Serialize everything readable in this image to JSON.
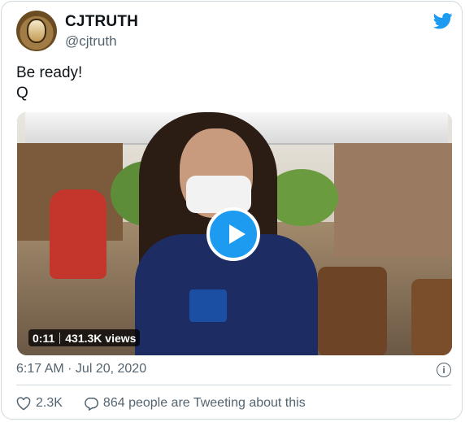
{
  "tweet": {
    "display_name": "CJTRUTH",
    "handle": "@cjtruth",
    "text_line1": "Be ready!",
    "text_line2": "Q",
    "timestamp": "6:17 AM · Jul 20, 2020"
  },
  "video": {
    "duration": "0:11",
    "views": "431.3K views"
  },
  "actions": {
    "likes": "2.3K",
    "tweeting": "864 people are Tweeting about this"
  },
  "icons": {
    "brand": "twitter-bird-icon",
    "play": "play-icon",
    "info": "info-icon",
    "like": "heart-icon",
    "reply": "speech-bubble-icon"
  },
  "colors": {
    "accent": "#1d9bf0",
    "secondary_text": "#536471",
    "border": "#cfd9de"
  }
}
